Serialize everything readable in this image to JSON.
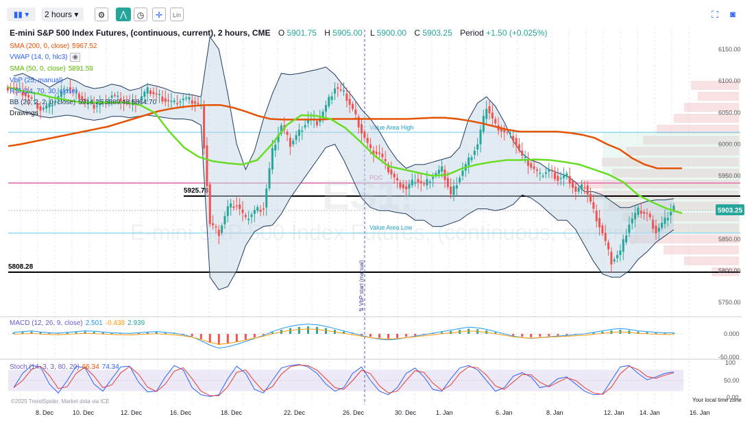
{
  "toolbar": {
    "interval": "2 hours",
    "scale_label": "Lin"
  },
  "header": {
    "title": "E-mini S&P 500 Index Futures, (continuous, current), 2 hours, CME",
    "o_label": "O",
    "o": "5901.75",
    "h_label": "H",
    "h": "5905.00",
    "l_label": "L",
    "l": "5900.00",
    "c_label": "C",
    "c": "5903.25",
    "period_label": "Period",
    "period": "+1.50 (+0.025%)"
  },
  "legend": {
    "sma200": {
      "label": "SMA (200, 0, close)",
      "value": "5967.52",
      "color": "#e65100"
    },
    "vwap": {
      "label": "VWAP (14, 0, hlc3)",
      "color": "#2962ff"
    },
    "sma50": {
      "label": "SMA (50, 0, close)",
      "value": "5891.59",
      "color": "#66dd22"
    },
    "vbp": {
      "label": "VbP (25, manual)"
    },
    "rsi": {
      "label": "RSI (14, 70, 30, close)"
    },
    "bb": {
      "label": "BB (20, 2, 2, 0, close)",
      "values": "5914.25  5889.48  5864.70"
    },
    "drawings": "Drawings"
  },
  "annotations": {
    "level_upper": "5925.78",
    "level_lower": "5808.28",
    "value_area_high": "Value Area High",
    "value_area_low": "Value Area Low",
    "poc": "POC",
    "vbp_start": "⇅ VbP start (manual)",
    "watermark": "ES1!",
    "watermark_sub": "E-mini S&P 500 Index Futures, (continuous, current)",
    "current_price": "5903.25"
  },
  "macd": {
    "label": "MACD (12, 26, 9, close)",
    "v1": "2.501",
    "v2": "-0.438",
    "v3": "2.939"
  },
  "stoch": {
    "label": "Stoch (14, 3, 3, 80, 20)",
    "v1": "66.34",
    "v2": "74.34"
  },
  "footer": {
    "copyright": "©2025 TrendSpider, Market data via ICE",
    "timezone": "Your local time zone"
  },
  "colors": {
    "up": "#26a69a",
    "down": "#ef5350",
    "sma200": "#e65100",
    "sma50": "#66dd22",
    "band": "#dbe3ec",
    "band_line": "#1e3a5f"
  },
  "chart_data": {
    "type": "candlestick",
    "x_ticks": [
      "8. Dec",
      "10. Dec",
      "12. Dec",
      "16. Dec",
      "18. Dec",
      "22. Dec",
      "26. Dec",
      "30. Dec",
      "1. Jan",
      "6. Jan",
      "8. Jan",
      "12. Jan",
      "14. Jan",
      "16. Jan"
    ],
    "price_ticks": [
      "6150.00",
      "6100.00",
      "6050.00",
      "6000.00",
      "5950.00",
      "5900.00",
      "5850.00",
      "5800.00",
      "5750.00"
    ],
    "ylim": [
      5728,
      6180
    ],
    "macd_ticks": [
      "0.000",
      "-50.000"
    ],
    "stoch_ticks": [
      "100",
      "50.00",
      "0.00"
    ],
    "close_path": [
      6090,
      6082,
      6070,
      6055,
      6060,
      6075,
      6090,
      6080,
      6068,
      6060,
      6065,
      6078,
      6070,
      6062,
      6070,
      6085,
      6078,
      6070,
      6065,
      6072,
      6068,
      6060,
      5875,
      5860,
      5900,
      5905,
      5880,
      5895,
      5900,
      5990,
      6030,
      6000,
      6020,
      6040,
      6035,
      6060,
      6090,
      6080,
      6055,
      6020,
      5990,
      5985,
      5960,
      5940,
      5930,
      5945,
      5935,
      5950,
      5960,
      5920,
      5950,
      5975,
      6000,
      6060,
      6030,
      6020,
      6010,
      5980,
      5965,
      5950,
      5960,
      5945,
      5950,
      5925,
      5935,
      5895,
      5860,
      5815,
      5830,
      5875,
      5895,
      5890,
      5862,
      5880,
      5903
    ],
    "bb_upper": [
      6108,
      6112,
      6105,
      6098,
      6090,
      6098,
      6105,
      6100,
      6092,
      6088,
      6090,
      6095,
      6092,
      6085,
      6088,
      6095,
      6092,
      6088,
      6082,
      6080,
      6078,
      6075,
      6170,
      6150,
      6080,
      6000,
      5960,
      5990,
      6040,
      6080,
      6112,
      6110,
      6112,
      6115,
      6118,
      6122,
      6110,
      6092,
      6075,
      6055,
      6040,
      6020,
      5995,
      5975,
      5962,
      5968,
      5968,
      5972,
      5976,
      5980,
      5995,
      6040,
      6065,
      6075,
      6060,
      6035,
      6005,
      5985,
      5975,
      5970,
      5960,
      5955,
      5950,
      5940,
      5925,
      5925,
      5920,
      5910,
      5900,
      5900,
      5905,
      5910,
      5912,
      5912,
      5914
    ],
    "bb_lower": [
      6058,
      6052,
      6048,
      6044,
      6042,
      6044,
      6046,
      6044,
      6040,
      6038,
      6040,
      6044,
      6044,
      6042,
      6044,
      6046,
      6044,
      6042,
      6040,
      6040,
      6038,
      6030,
      5790,
      5770,
      5775,
      5800,
      5840,
      5862,
      5870,
      5872,
      5890,
      5915,
      5935,
      5955,
      5975,
      5995,
      6000,
      5975,
      5945,
      5915,
      5900,
      5895,
      5895,
      5892,
      5890,
      5880,
      5880,
      5870,
      5870,
      5875,
      5880,
      5890,
      5898,
      5898,
      5895,
      5898,
      5905,
      5920,
      5915,
      5905,
      5892,
      5880,
      5880,
      5865,
      5840,
      5815,
      5795,
      5790,
      5790,
      5800,
      5818,
      5830,
      5845,
      5855,
      5865
    ],
    "sma200": [
      5997,
      6000,
      6004,
      6008,
      6012,
      6016,
      6020,
      6024,
      6028,
      6034,
      6040,
      6046,
      6052,
      6056,
      6059,
      6061,
      6062,
      6062,
      6058,
      6052,
      6045,
      6040,
      6039,
      6039,
      6039,
      6039,
      6040,
      6040,
      6040,
      6040,
      6040,
      6040,
      6040,
      6041,
      6042,
      6042,
      6040,
      6037,
      6033,
      6028,
      6023,
      6020,
      6020,
      6020,
      6020,
      6018,
      6015,
      6010,
      6000,
      5992,
      5978,
      5968,
      5962,
      5962,
      5962
    ],
    "sma50": [
      6090,
      6084,
      6080,
      6074,
      6070,
      6066,
      6066,
      6066,
      6066,
      6062,
      6050,
      6020,
      5995,
      5980,
      5973,
      5970,
      5968,
      5975,
      6000,
      6030,
      6046,
      6045,
      6040,
      6026,
      6005,
      5982,
      5965,
      5960,
      5955,
      5950,
      5952,
      5962,
      5968,
      5972,
      5975,
      5975,
      5976,
      5975,
      5972,
      5968,
      5960,
      5952,
      5940,
      5920,
      5908,
      5898,
      5891
    ],
    "macd_histogram": [
      4,
      6,
      8,
      5,
      3,
      2,
      4,
      6,
      8,
      7,
      5,
      3,
      2,
      1,
      3,
      5,
      6,
      4,
      2,
      -2,
      -8,
      -18,
      -30,
      -38,
      -34,
      -28,
      -20,
      -12,
      -4,
      6,
      14,
      20,
      24,
      26,
      24,
      20,
      14,
      8,
      2,
      -4,
      -10,
      -14,
      -16,
      -14,
      -10,
      -6,
      -2,
      2,
      6,
      10,
      14,
      18,
      16,
      12,
      6,
      0,
      -6,
      -10,
      -12,
      -10,
      -8,
      -6,
      -4,
      -2,
      0,
      4,
      8,
      12,
      14,
      12,
      8,
      6,
      4,
      3,
      3
    ],
    "stoch_k": [
      30,
      70,
      92,
      88,
      40,
      15,
      50,
      90,
      85,
      40,
      20,
      55,
      88,
      90,
      45,
      18,
      20,
      60,
      92,
      80,
      30,
      10,
      5,
      10,
      55,
      90,
      70,
      25,
      15,
      50,
      85,
      92,
      95,
      88,
      70,
      40,
      20,
      30,
      70,
      88,
      50,
      20,
      10,
      30,
      70,
      85,
      60,
      25,
      20,
      55,
      85,
      92,
      80,
      50,
      20,
      30,
      62,
      72,
      60,
      30,
      35,
      55,
      60,
      40,
      20,
      10,
      12,
      50,
      88,
      92,
      70,
      52,
      60,
      70,
      74
    ]
  }
}
